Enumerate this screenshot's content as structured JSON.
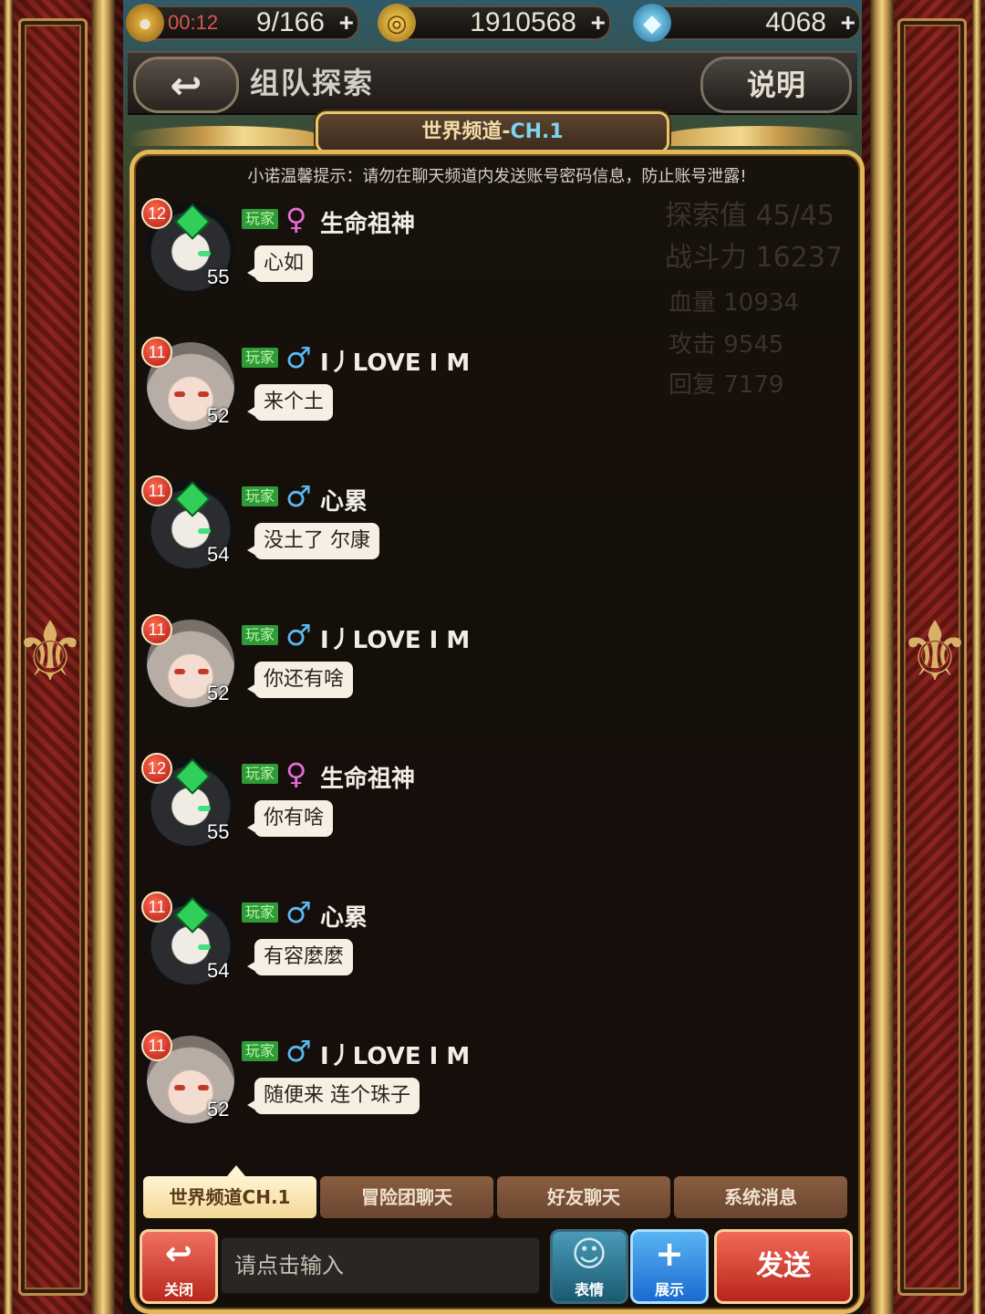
{
  "resources": {
    "stamina_timer": "00:12",
    "stamina": "9/166",
    "gold": "1910568",
    "gems": "4068",
    "plus": "+"
  },
  "header": {
    "back_icon": "back-arrow-icon",
    "title": "组队探索",
    "help_label": "说明"
  },
  "channel": {
    "name": "世界频道-",
    "code": "CH.1"
  },
  "notice": "小诺温馨提示：请勿在聊天频道内发送账号密码信息，防止账号泄露!",
  "background_stats": {
    "explore": "探索值 45/45",
    "power": "战斗力 16237",
    "hp": "血量  10934",
    "attack": "攻击  9545",
    "recover": "回复  7179"
  },
  "messages": [
    {
      "badge": "12",
      "level": "55",
      "tag": "玩家",
      "gender": "♀",
      "name": "生命祖神",
      "text": "心如"
    },
    {
      "badge": "11",
      "level": "52",
      "tag": "玩家",
      "gender": "♂",
      "name": "I丿LOVE I M",
      "text": "来个土"
    },
    {
      "badge": "11",
      "level": "54",
      "tag": "玩家",
      "gender": "♂",
      "name": "心累",
      "text": "没土了 尔康"
    },
    {
      "badge": "11",
      "level": "52",
      "tag": "玩家",
      "gender": "♂",
      "name": "I丿LOVE I M",
      "text": "你还有啥"
    },
    {
      "badge": "12",
      "level": "55",
      "tag": "玩家",
      "gender": "♀",
      "name": "生命祖神",
      "text": "你有啥"
    },
    {
      "badge": "11",
      "level": "54",
      "tag": "玩家",
      "gender": "♂",
      "name": "心累",
      "text": "有容麼麼"
    },
    {
      "badge": "11",
      "level": "52",
      "tag": "玩家",
      "gender": "♂",
      "name": "I丿LOVE I M",
      "text": "随便来 连个珠子"
    }
  ],
  "tabs": [
    "世界频道CH.1",
    "冒险团聊天",
    "好友聊天",
    "系统消息"
  ],
  "input": {
    "close_label": "关闭",
    "placeholder": "请点击输入",
    "emote_label": "表情",
    "show_label": "展示",
    "send_label": "发送"
  },
  "colors": {
    "panel_border": "#e2b85a",
    "tag_green": "#2e9a38",
    "female": "#e86ad8",
    "male": "#5ab8f0",
    "send_red": "#d8382a"
  }
}
